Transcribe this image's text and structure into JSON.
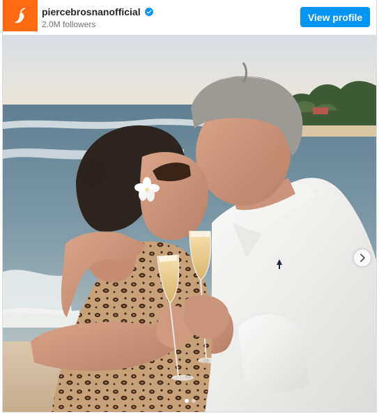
{
  "post": {
    "username": "piercebrosnanofficial",
    "verified_icon": "verified-badge-icon",
    "followers": "2.0M followers",
    "view_profile_label": "View profile",
    "avatar_icon": "chili-pepper-icon",
    "avatar_color": "#ff6a13",
    "button_color": "#0095f6",
    "carousel": {
      "next_icon": "chevron-right-icon",
      "dot_count": 2,
      "active_dot": 1
    }
  }
}
